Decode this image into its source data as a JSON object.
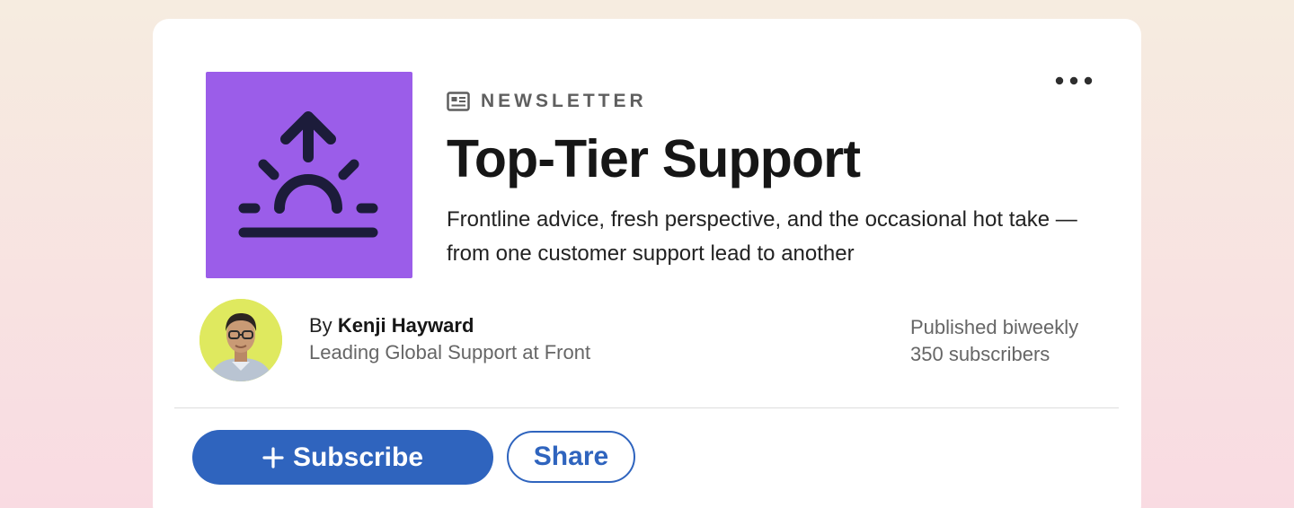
{
  "newsletter": {
    "label": "NEWSLETTER",
    "title": "Top-Tier Support",
    "description": "Frontline advice, fresh perspective, and the occasional hot take — from one customer support lead to another",
    "logo_icon": "sunrise-arrow-icon",
    "logo_color": "#9b5de9"
  },
  "author": {
    "by_prefix": "By",
    "name": "Kenji Hayward",
    "role": "Leading Global Support at Front"
  },
  "meta": {
    "frequency": "Published biweekly",
    "subscribers": "350 subscribers"
  },
  "actions": {
    "subscribe_label": "Subscribe",
    "share_label": "Share",
    "more_icon": "more-horizontal-icon"
  },
  "colors": {
    "accent": "#2f64be",
    "title": "#161616",
    "muted": "#666666"
  }
}
